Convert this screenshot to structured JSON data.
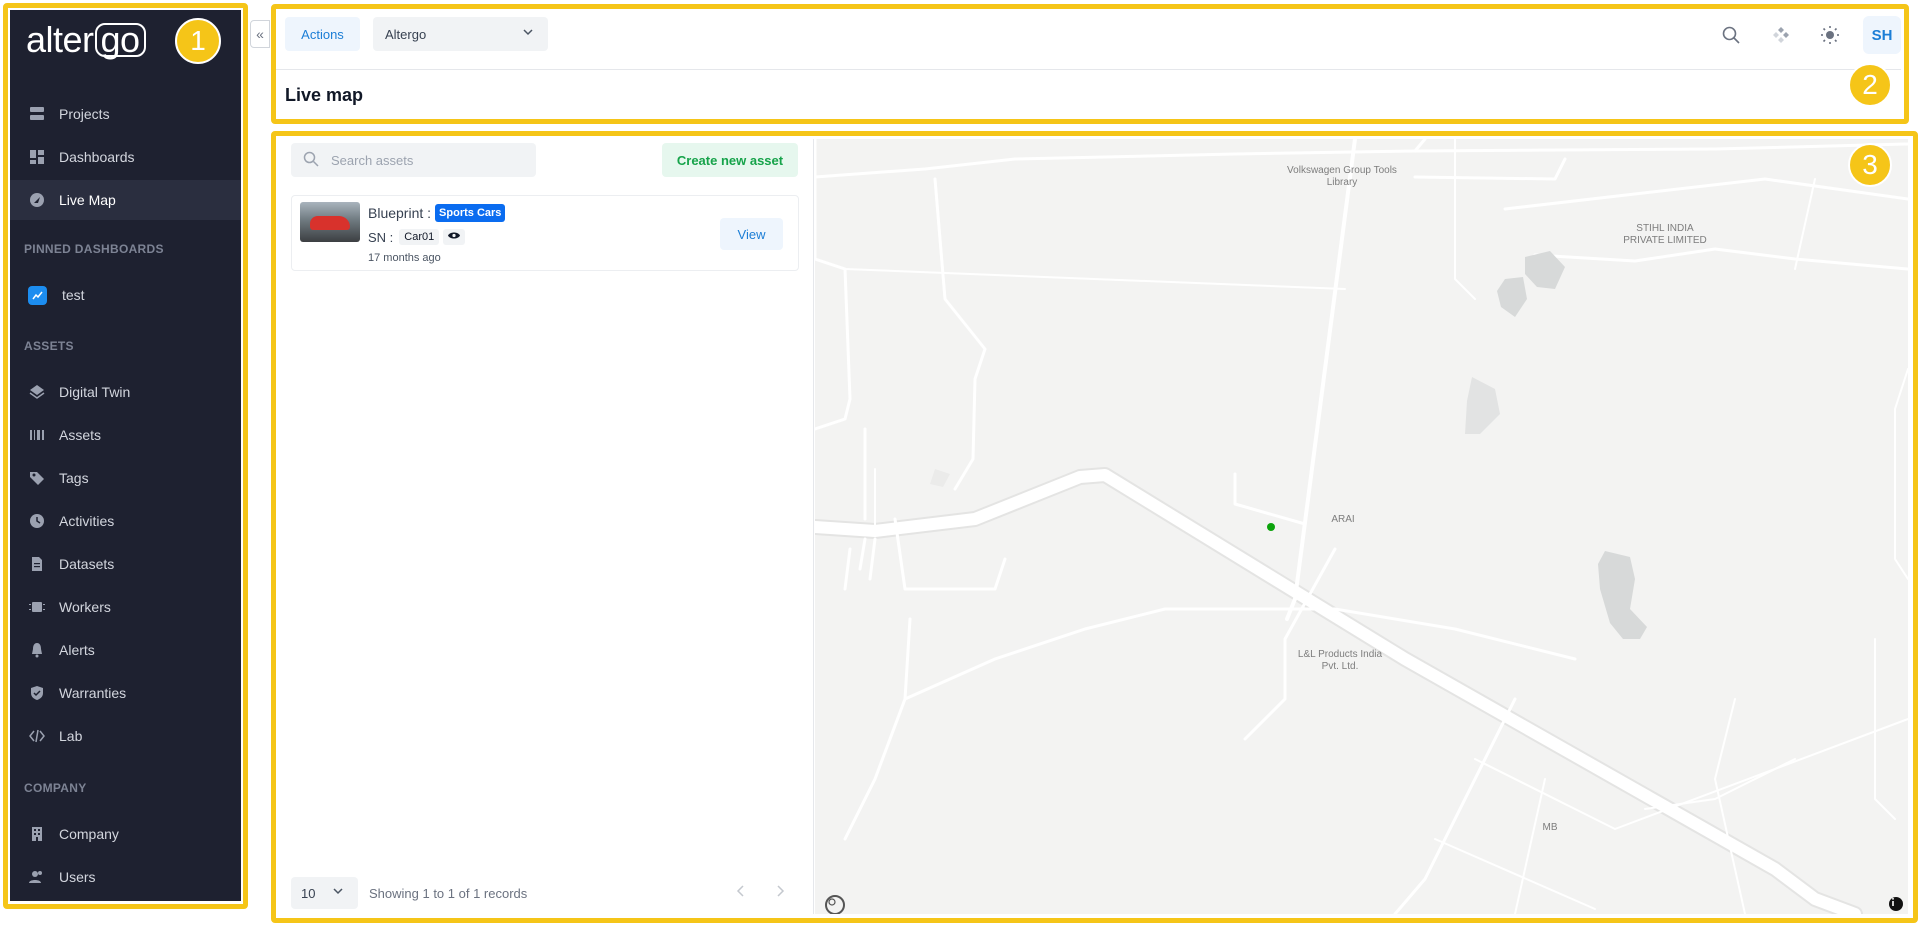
{
  "sidebar": {
    "logo_text": "alter",
    "logo_boxed": "go",
    "collapse_icon": "«",
    "items_top": [
      {
        "label": "Projects",
        "icon": "projects-icon"
      },
      {
        "label": "Dashboards",
        "icon": "dashboards-icon"
      },
      {
        "label": "Live Map",
        "icon": "live-map-icon",
        "active": true
      }
    ],
    "pinned_section": "PINNED DASHBOARDS",
    "pinned": [
      {
        "label": "test",
        "icon": "chart-icon"
      }
    ],
    "assets_section": "ASSETS",
    "assets": [
      {
        "label": "Digital Twin",
        "icon": "layers-icon"
      },
      {
        "label": "Assets",
        "icon": "assets-icon"
      },
      {
        "label": "Tags",
        "icon": "tag-icon"
      },
      {
        "label": "Activities",
        "icon": "clock-icon"
      },
      {
        "label": "Datasets",
        "icon": "file-icon"
      },
      {
        "label": "Workers",
        "icon": "cpu-icon"
      },
      {
        "label": "Alerts",
        "icon": "bell-icon"
      },
      {
        "label": "Warranties",
        "icon": "shield-icon"
      },
      {
        "label": "Lab",
        "icon": "code-icon"
      }
    ],
    "company_section": "COMPANY",
    "company": [
      {
        "label": "Company",
        "icon": "building-icon"
      },
      {
        "label": "Users",
        "icon": "users-icon"
      }
    ]
  },
  "header": {
    "actions_label": "Actions",
    "org_select": "Altergo",
    "page_title": "Live map",
    "avatar_initials": "SH"
  },
  "list": {
    "search_placeholder": "Search assets",
    "create_label": "Create new asset",
    "records": [
      {
        "blueprint_label": "Blueprint :",
        "blueprint": "Sports Cars",
        "sn_label": "SN :",
        "sn": "Car01",
        "ago": "17 months ago",
        "view_label": "View"
      }
    ],
    "per_page": "10",
    "pager_text": "Showing 1 to 1 of 1 records"
  },
  "map": {
    "labels": {
      "vw": "Volkswagen Group Tools Library",
      "stihl": "STIHL INDIA PRIVATE LIMITED",
      "arai": "ARAI",
      "ll": "L&L Products India Pvt. Ltd.",
      "mb": "MB"
    }
  },
  "annotations": [
    "1",
    "2",
    "3"
  ],
  "colors": {
    "sidebar_bg": "#1e2130",
    "accent": "#1c7ed6",
    "create_green": "#16a34a",
    "annotation_yellow": "#f5c518",
    "asset_dot": "#0ca30c"
  }
}
